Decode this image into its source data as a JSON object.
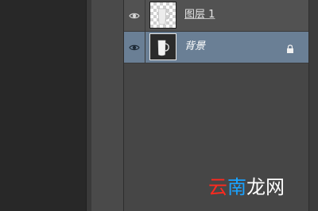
{
  "layers": [
    {
      "name": "图层 1",
      "visible": true,
      "thumbnail": "transparent-cup-icon"
    },
    {
      "name": "背景",
      "visible": true,
      "selected": true,
      "locked": true,
      "thumbnail": "cup-on-dark-icon"
    }
  ],
  "watermark": {
    "text_1": "云",
    "text_2": "南",
    "text_3": "龙",
    "text_4": "网"
  },
  "colors": {
    "selected_row": "#6a7f95",
    "panel": "#464646",
    "row": "#525252"
  }
}
